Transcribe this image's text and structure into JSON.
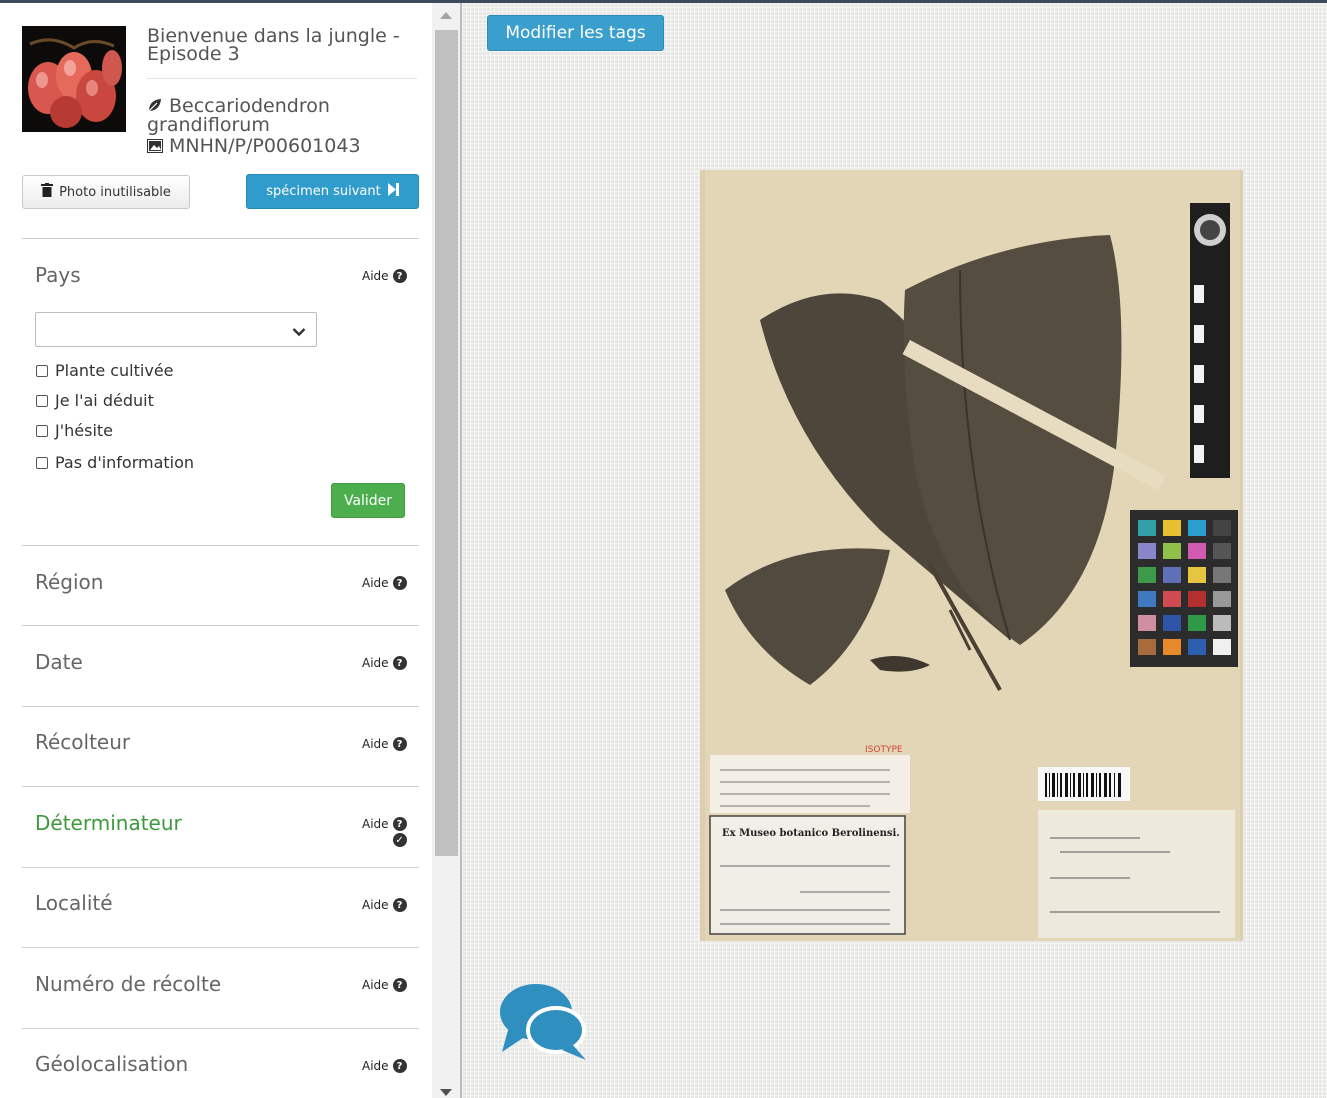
{
  "header": {
    "title": "Bienvenue dans la jungle - Episode 3",
    "species": "Beccariodendron grandiflorum",
    "specimen_code": "MNHN/P/P00601043"
  },
  "actions": {
    "unusable_label": "Photo inutilisable",
    "next_label": "spécimen suivant"
  },
  "form": {
    "pays": {
      "title": "Pays",
      "aide": "Aide",
      "select_value": "",
      "checkboxes": [
        "Plante cultivée",
        "Je l'ai déduit",
        "J'hésite",
        "Pas d'information"
      ],
      "submit_label": "Valider"
    },
    "sections": [
      {
        "title": "Région",
        "aide": "Aide"
      },
      {
        "title": "Date",
        "aide": "Aide"
      },
      {
        "title": "Récolteur",
        "aide": "Aide"
      },
      {
        "title": "Déterminateur",
        "aide": "Aide"
      },
      {
        "title": "Localité",
        "aide": "Aide"
      },
      {
        "title": "Numéro de récolte",
        "aide": "Aide"
      },
      {
        "title": "Géolocalisation",
        "aide": "Aide"
      }
    ]
  },
  "main": {
    "edit_tags_label": "Modifier les tags",
    "specimen_labels": {
      "isotype": "ISOTYPE",
      "museum": "Ex Museo botanico Berolinensi."
    }
  },
  "colors": {
    "primary_blue": "#2f9ccc",
    "success_green": "#4cae4c",
    "active_section_green": "#3d9a3d",
    "chat_icon": "#2f8fbf"
  },
  "icons": {
    "leaf": "leaf-icon",
    "image": "image-icon",
    "trash": "trash-icon",
    "next": "step-forward-icon",
    "help": "question-circle-icon",
    "chat": "chat-bubbles-icon"
  }
}
